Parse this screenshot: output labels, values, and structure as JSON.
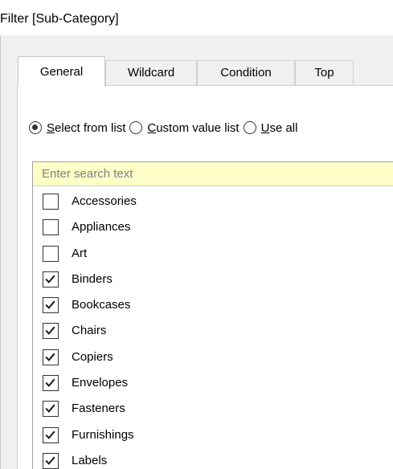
{
  "window": {
    "title": "Filter [Sub-Category]"
  },
  "tabs": [
    {
      "label": "General",
      "active": true
    },
    {
      "label": "Wildcard",
      "active": false
    },
    {
      "label": "Condition",
      "active": false
    },
    {
      "label": "Top",
      "active": false
    }
  ],
  "radio_options": [
    {
      "accel": "S",
      "rest": "elect from list",
      "selected": true
    },
    {
      "accel": "C",
      "rest": "ustom value list",
      "selected": false
    },
    {
      "accel": "U",
      "rest": "se all",
      "selected": false
    }
  ],
  "search": {
    "placeholder": "Enter search text",
    "value": ""
  },
  "items": [
    {
      "label": "Accessories",
      "checked": false
    },
    {
      "label": "Appliances",
      "checked": false
    },
    {
      "label": "Art",
      "checked": false
    },
    {
      "label": "Binders",
      "checked": true
    },
    {
      "label": "Bookcases",
      "checked": true
    },
    {
      "label": "Chairs",
      "checked": true
    },
    {
      "label": "Copiers",
      "checked": true
    },
    {
      "label": "Envelopes",
      "checked": true
    },
    {
      "label": "Fasteners",
      "checked": true
    },
    {
      "label": "Furnishings",
      "checked": true
    },
    {
      "label": "Labels",
      "checked": true
    }
  ],
  "colors": {
    "search_background": "#ffffc8",
    "dialog_background": "#f0f0f0",
    "border": "#a0a0a0"
  },
  "icons": {
    "checked": "checkmark-icon",
    "radio_selected": "radio-dot-icon"
  }
}
